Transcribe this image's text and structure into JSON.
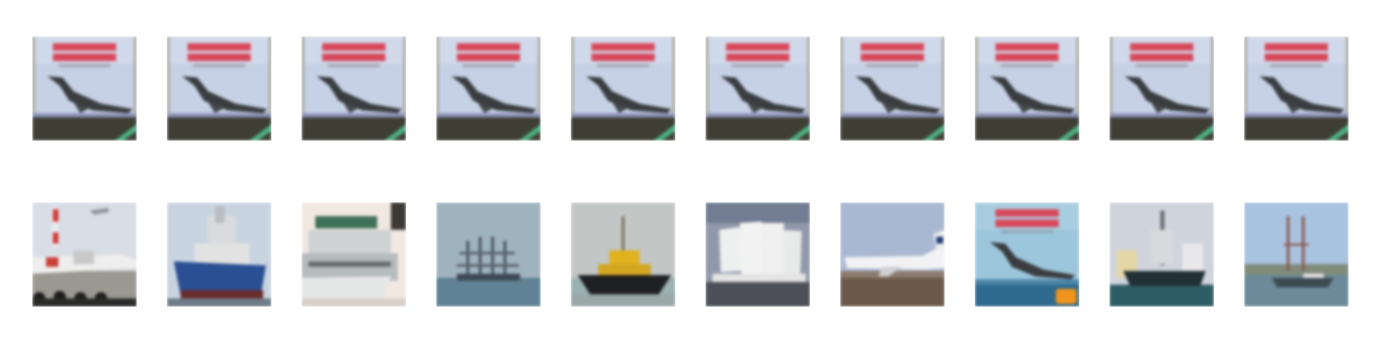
{
  "grid": {
    "rows": 2,
    "columns": 10,
    "top_row": [
      {
        "subject": "concorde-poster"
      },
      {
        "subject": "concorde-poster"
      },
      {
        "subject": "concorde-poster"
      },
      {
        "subject": "concorde-poster"
      },
      {
        "subject": "concorde-poster"
      },
      {
        "subject": "concorde-poster"
      },
      {
        "subject": "concorde-poster"
      },
      {
        "subject": "concorde-poster"
      },
      {
        "subject": "concorde-poster"
      },
      {
        "subject": "concorde-poster"
      }
    ],
    "bottom_row": [
      {
        "subject": "airplane-on-tarmac"
      },
      {
        "subject": "blue-cargo-ship"
      },
      {
        "subject": "white-ferry"
      },
      {
        "subject": "distant-tall-ship"
      },
      {
        "subject": "yellow-tugboat"
      },
      {
        "subject": "white-sailing-ship"
      },
      {
        "subject": "airliner-on-runway"
      },
      {
        "subject": "concorde-poster"
      },
      {
        "subject": "oil-rig-ship"
      },
      {
        "subject": "harbor-boat"
      }
    ]
  },
  "colors": {
    "poster_sky": "#c4d0e4",
    "poster_title": "#d8485a",
    "plane_dark": "#3a3d40",
    "grass_dark": "#3e3e34",
    "sea": "#5d8090",
    "background": "#ffffff"
  }
}
